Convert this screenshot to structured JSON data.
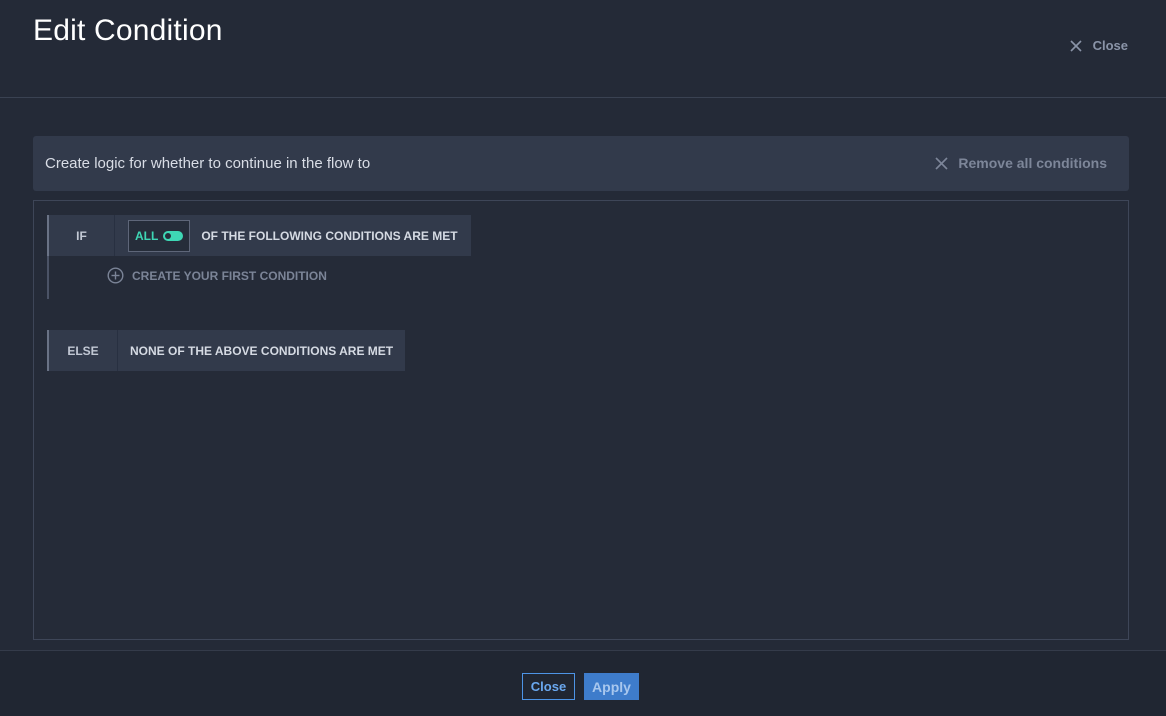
{
  "header": {
    "title": "Edit Condition",
    "close_label": "Close"
  },
  "banner": {
    "text": "Create logic for whether to continue in the flow to",
    "remove_all_label": "Remove all conditions"
  },
  "if_block": {
    "label": "IF",
    "toggle_label": "ALL",
    "toggle_on": true,
    "text": "OF THE FOLLOWING CONDITIONS ARE MET",
    "create_first_label": "CREATE YOUR FIRST CONDITION"
  },
  "else_block": {
    "label": "ELSE",
    "text": "NONE OF THE ABOVE CONDITIONS ARE MET"
  },
  "footer": {
    "close_label": "Close",
    "apply_label": "Apply"
  },
  "colors": {
    "accent_teal": "#3ed7b5",
    "primary_blue": "#3e7ccb",
    "background": "#242a37"
  },
  "icons": {
    "close": "close-icon",
    "remove_all": "close-icon",
    "add": "plus-circle-icon"
  }
}
